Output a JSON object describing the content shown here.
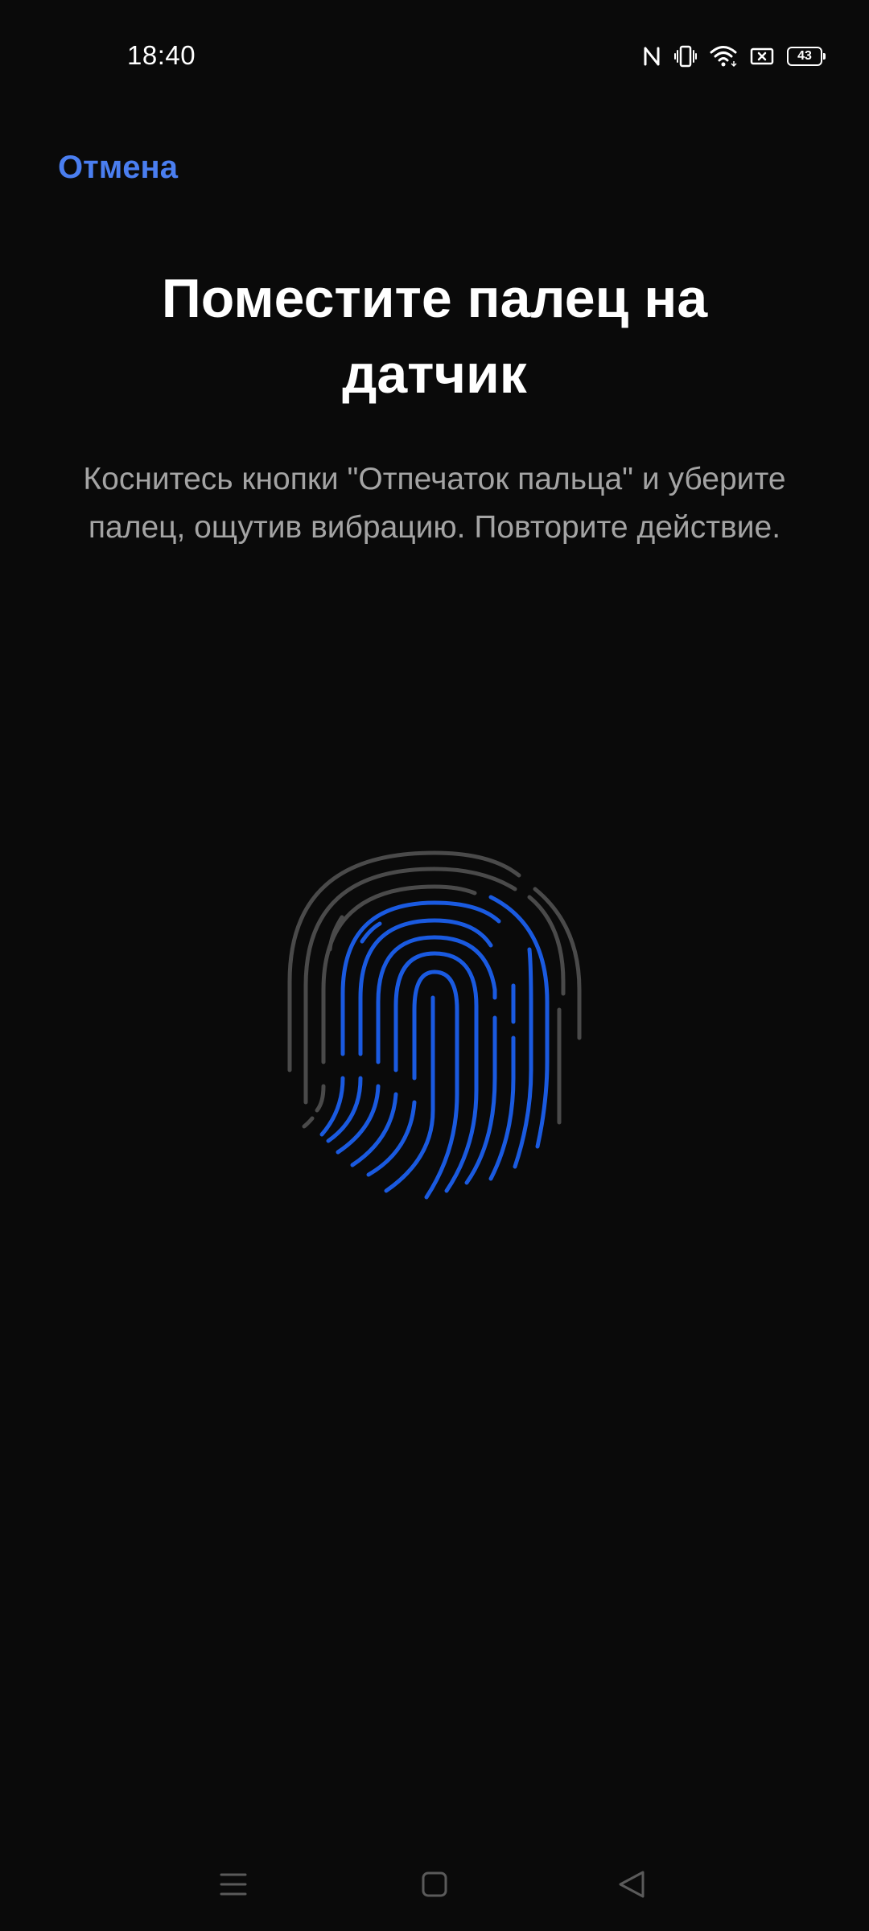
{
  "status_bar": {
    "time": "18:40",
    "battery_level": "43",
    "icons": [
      "nfc-icon",
      "vibrate-icon",
      "wifi-icon",
      "screen-cast-icon",
      "battery-icon"
    ]
  },
  "header": {
    "cancel_label": "Отмена"
  },
  "main": {
    "title": "Поместите палец на датчик",
    "description": "Коснитесь кнопки \"Отпечаток пальца\" и уберите палец, ощутив вибрацию. Повторите действие.",
    "fingerprint": {
      "progress_color": "#1a5ae0",
      "base_color": "#4a4a4a"
    }
  },
  "nav_bar": {
    "buttons": [
      "menu-icon",
      "home-icon",
      "back-icon"
    ]
  },
  "colors": {
    "background": "#0a0a0a",
    "accent": "#4a7ef0",
    "text_secondary": "#a4a4a4"
  }
}
